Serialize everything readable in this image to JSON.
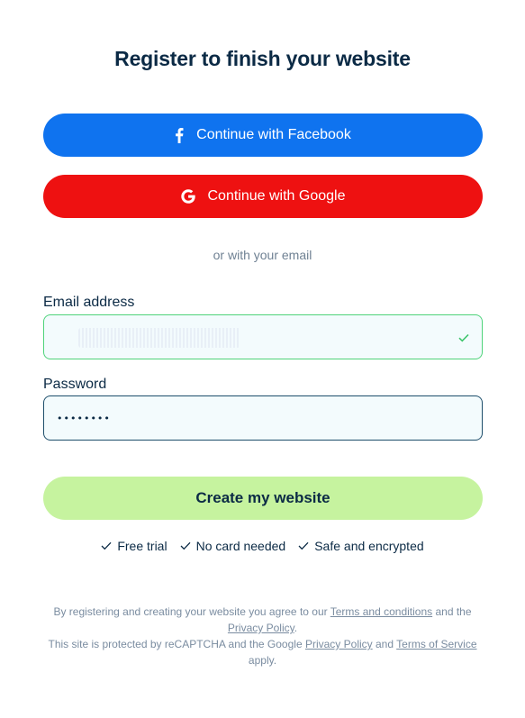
{
  "header": {
    "title": "Register to finish your website"
  },
  "social": {
    "facebook_label": "Continue with Facebook",
    "google_label": "Continue with Google",
    "facebook_color": "#0f73ef",
    "google_color": "#ee1111"
  },
  "divider": {
    "text": "or with your email"
  },
  "form": {
    "email_label": "Email address",
    "email_value": "",
    "email_valid_icon": "checkmark-icon",
    "password_label": "Password",
    "password_value": "••••••••"
  },
  "submit": {
    "label": "Create my website",
    "color": "#c6f39f"
  },
  "features": [
    {
      "icon": "checkmark-icon",
      "label": "Free trial"
    },
    {
      "icon": "checkmark-icon",
      "label": "No card needed"
    },
    {
      "icon": "checkmark-icon",
      "label": "Safe and encrypted"
    }
  ],
  "legal": {
    "line1_prefix": "By registering and creating your website you agree to our",
    "terms_link": "Terms and conditions",
    "line1_middle": "and the",
    "privacy_link": "Privacy Policy",
    "line1_suffix": ".",
    "line2_prefix": "This site is protected by reCAPTCHA and the Google",
    "google_privacy_link": "Privacy Policy",
    "line2_and": "and",
    "google_terms_link": "Terms of Service",
    "line2_suffix": "apply."
  }
}
